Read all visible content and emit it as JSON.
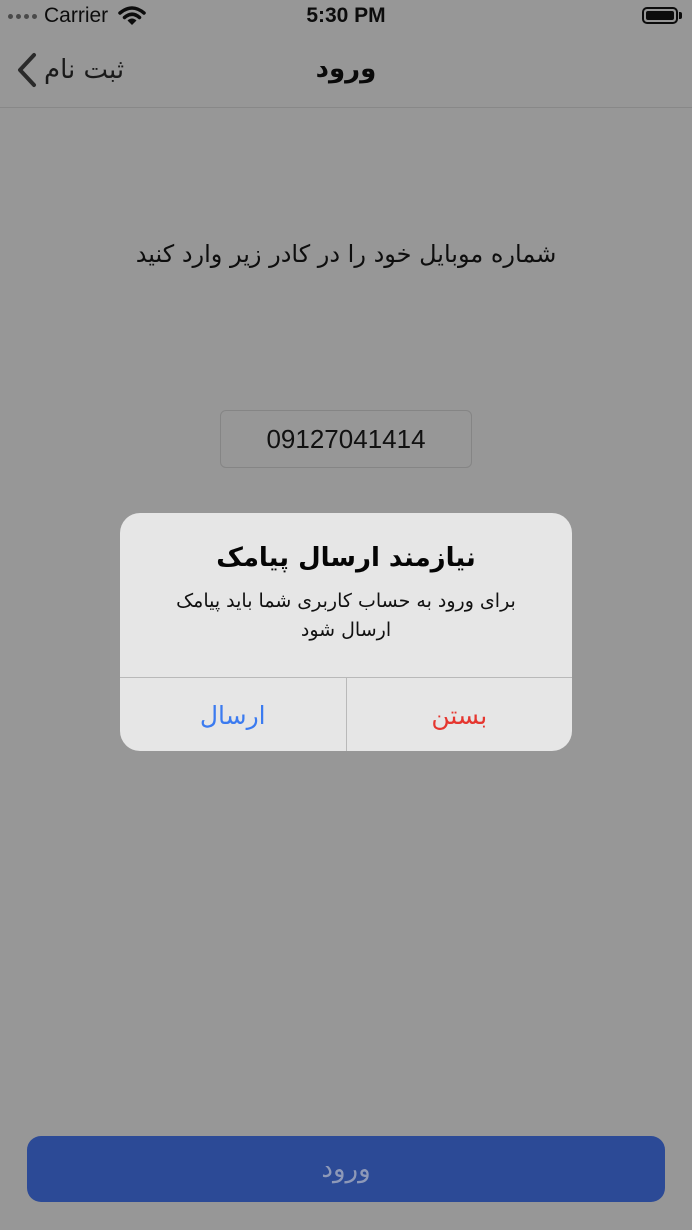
{
  "status_bar": {
    "carrier": "Carrier",
    "time": "5:30 PM"
  },
  "nav": {
    "back_label": "ثبت نام",
    "title": "ورود"
  },
  "content": {
    "instruction": "شماره موبایل خود را در کادر زیر وارد کنید",
    "phone_value": "09127041414"
  },
  "alert": {
    "title": "نیازمند ارسال پیامک",
    "message": "برای ورود به حساب کاربری شما باید پیامک ارسال شود",
    "send_label": "ارسال",
    "close_label": "بستن"
  },
  "footer": {
    "login_label": "ورود"
  },
  "icons": {
    "back": "chevron-left-icon",
    "wifi": "wifi-icon",
    "battery": "battery-icon",
    "signal": "signal-dots-icon"
  },
  "colors": {
    "overlay_background": "#979797",
    "alert_send": "#3b7bf0",
    "alert_close": "#e5362f",
    "login_button": "#2c4a96"
  }
}
